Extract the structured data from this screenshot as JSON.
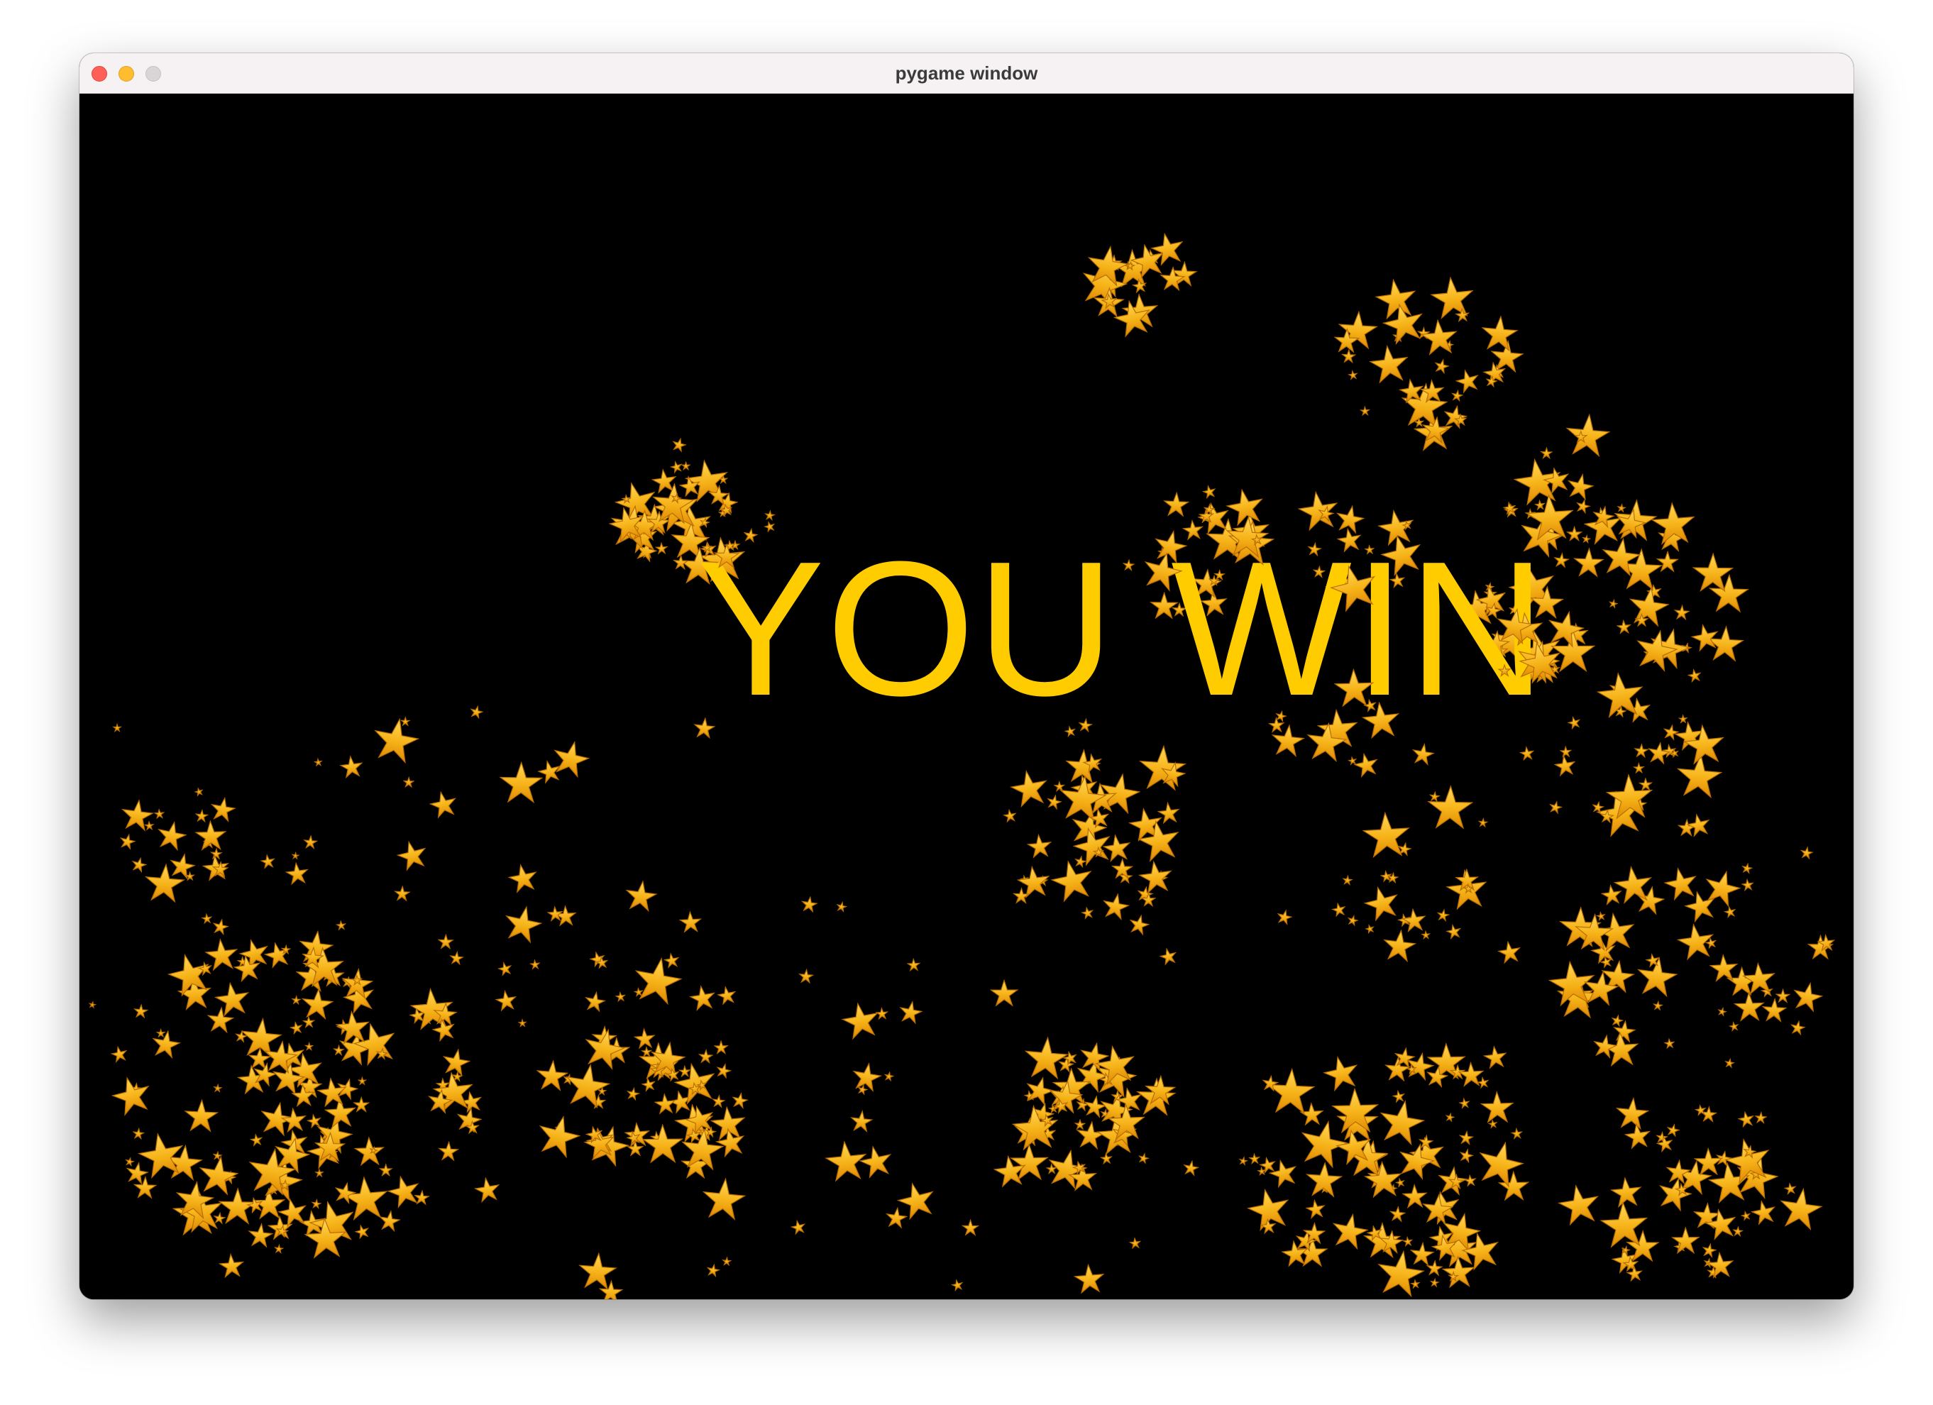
{
  "window": {
    "title": "pygame window"
  },
  "game": {
    "message": "YOU WIN",
    "message_color": "#ffcc00",
    "background_color": "#000000",
    "particle": "star-icon",
    "particle_color": "#f6b318"
  }
}
